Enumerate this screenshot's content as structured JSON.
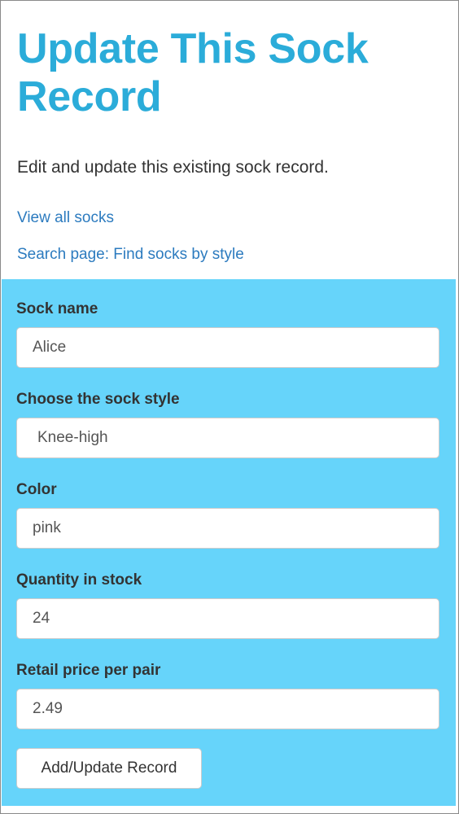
{
  "header": {
    "title": "Update This Sock Record"
  },
  "intro": "Edit and update this existing sock record.",
  "nav": {
    "view_all": "View all socks",
    "search_page": "Search page: Find socks by style"
  },
  "form": {
    "fields": [
      {
        "label": "Sock name",
        "value": "Alice"
      },
      {
        "label": "Choose the sock style",
        "value": "Knee-high"
      },
      {
        "label": "Color",
        "value": "pink"
      },
      {
        "label": "Quantity in stock",
        "value": "24"
      },
      {
        "label": "Retail price per pair",
        "value": "2.49"
      }
    ],
    "submit_label": "Add/Update Record"
  },
  "colors": {
    "title": "#2bacd9",
    "link": "#2c7bbf",
    "panel": "#66d4fa"
  }
}
